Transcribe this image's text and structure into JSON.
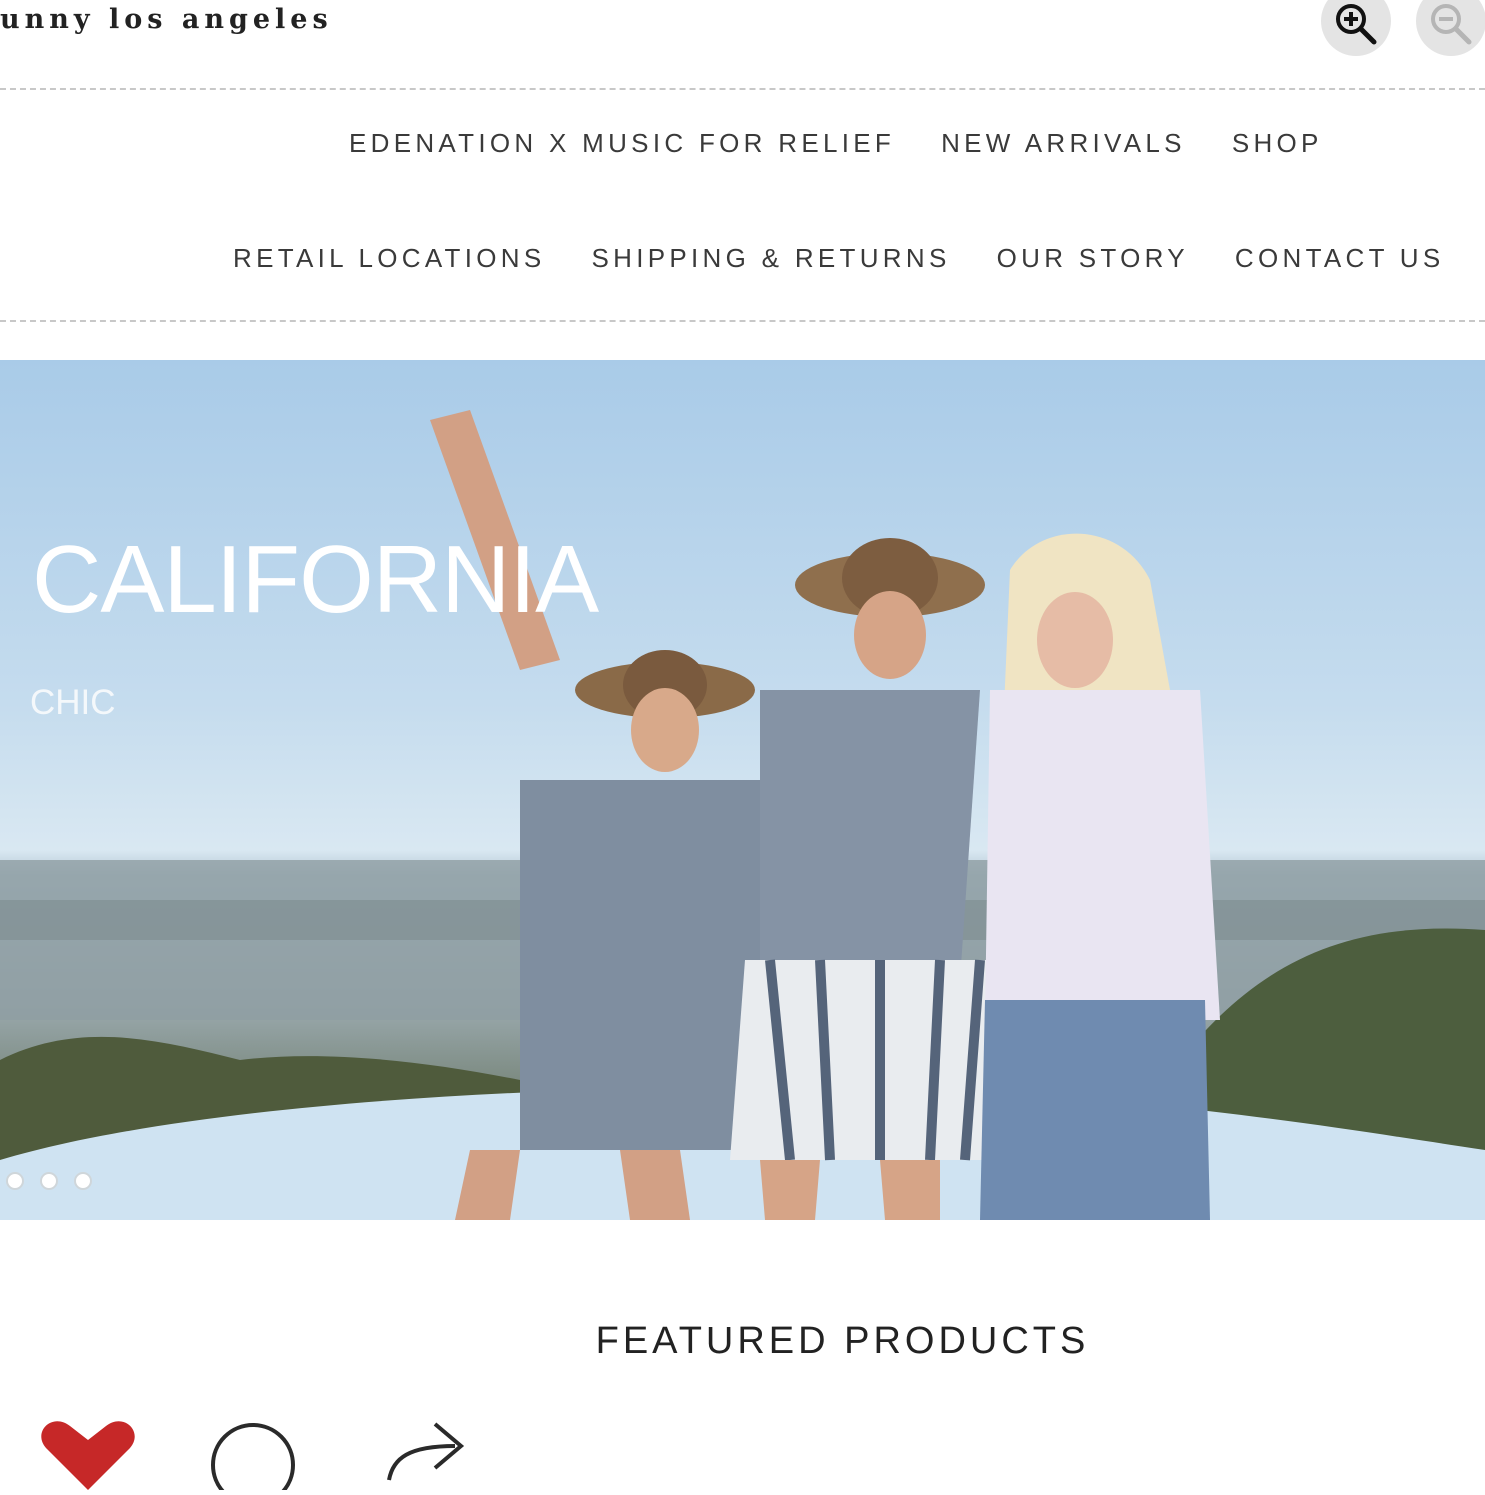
{
  "brand": {
    "name": "unny los angeles"
  },
  "zoom": {
    "in_icon": "zoom-in-icon",
    "out_icon": "zoom-out-icon"
  },
  "nav": {
    "row1": [
      "EDENATION X MUSIC FOR RELIEF",
      "NEW ARRIVALS",
      "SHOP"
    ],
    "row2": [
      "RETAIL LOCATIONS",
      "SHIPPING & RETURNS",
      "OUR STORY",
      "CONTACT US"
    ]
  },
  "hero": {
    "title": "CALIFORNIA",
    "subtitle": "CHIC",
    "slide_count": 3
  },
  "featured": {
    "title": "FEATURED PRODUCTS"
  },
  "actions": {
    "like_icon": "heart-icon",
    "comment_icon": "comment-icon",
    "share_icon": "share-icon"
  },
  "colors": {
    "like": "#c62828",
    "nav_text": "#3a3a3a",
    "hero_text": "#ffffff"
  }
}
